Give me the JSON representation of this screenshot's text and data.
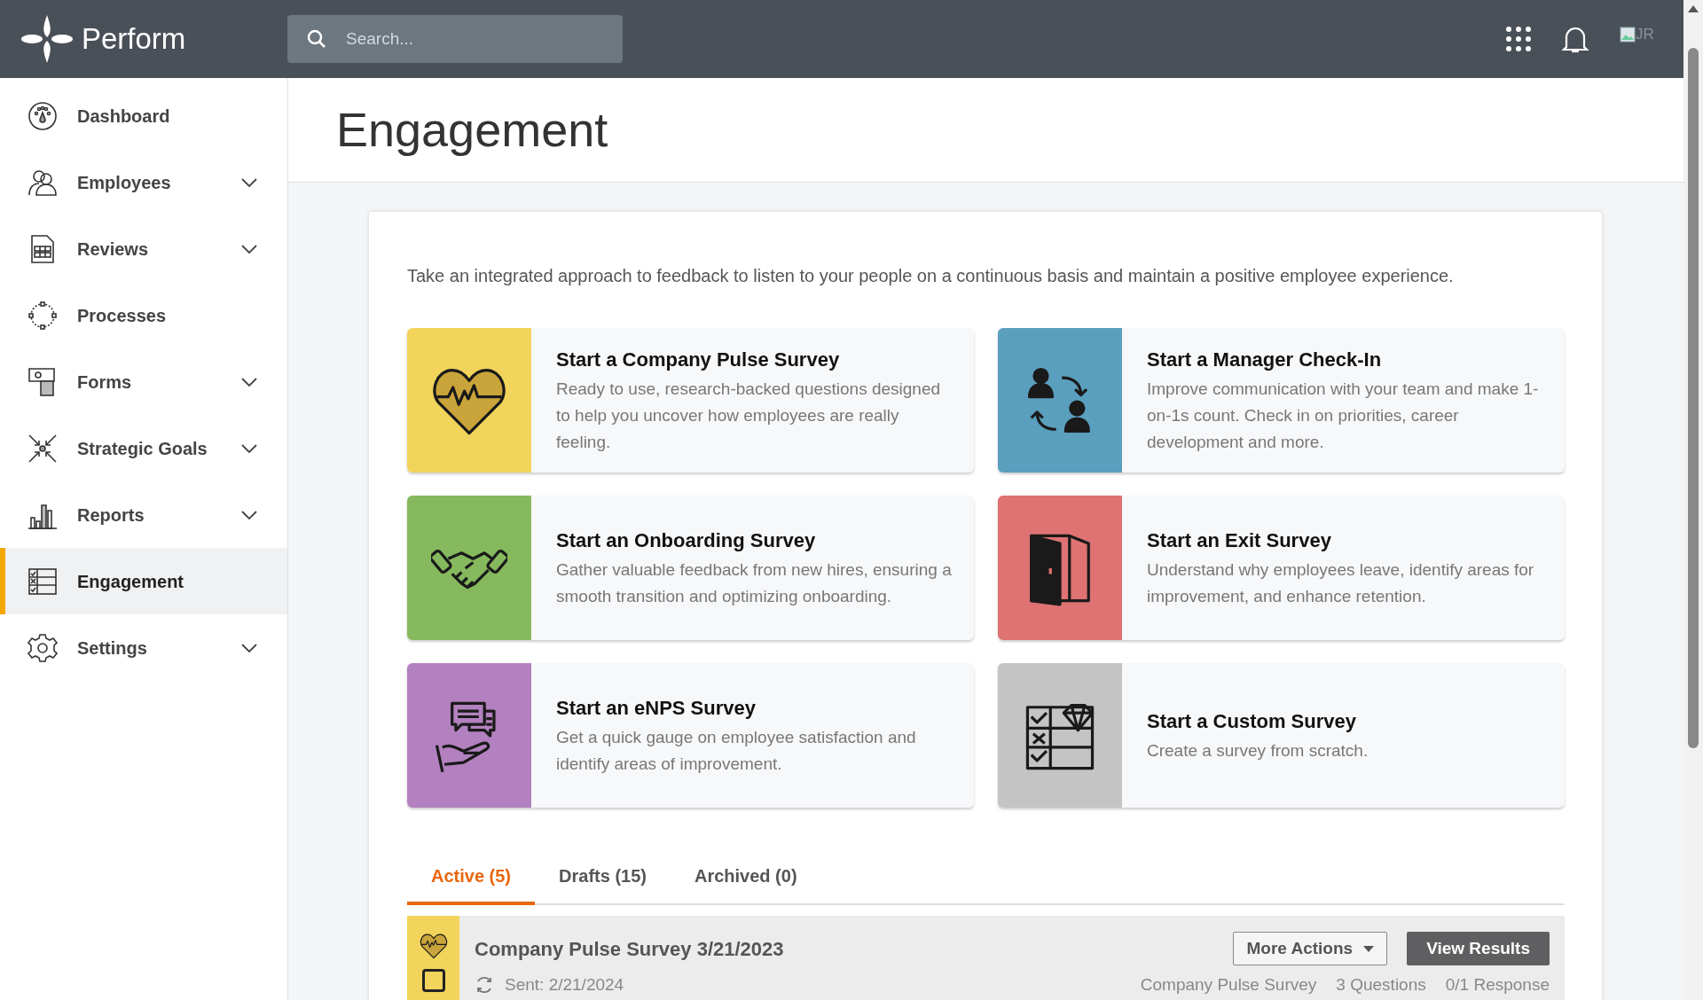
{
  "app": {
    "name": "Perform"
  },
  "search": {
    "placeholder": "Search..."
  },
  "user": {
    "initials": "JR"
  },
  "sidebar": {
    "items": [
      {
        "label": "Dashboard",
        "kind": "dashboard",
        "expandable": false,
        "selected": false
      },
      {
        "label": "Employees",
        "kind": "employees",
        "expandable": true,
        "selected": false
      },
      {
        "label": "Reviews",
        "kind": "reviews",
        "expandable": true,
        "selected": false
      },
      {
        "label": "Processes",
        "kind": "processes",
        "expandable": false,
        "selected": false
      },
      {
        "label": "Forms",
        "kind": "forms",
        "expandable": true,
        "selected": false
      },
      {
        "label": "Strategic Goals",
        "kind": "goals",
        "expandable": true,
        "selected": false
      },
      {
        "label": "Reports",
        "kind": "reports",
        "expandable": true,
        "selected": false
      },
      {
        "label": "Engagement",
        "kind": "engagement",
        "expandable": false,
        "selected": true
      },
      {
        "label": "Settings",
        "kind": "settings",
        "expandable": true,
        "selected": false
      }
    ]
  },
  "page": {
    "title": "Engagement"
  },
  "intro": "Take an integrated approach to feedback to listen to your people on a continuous basis and maintain a positive employee experience.",
  "templates": [
    {
      "title": "Start a Company Pulse Survey",
      "description": "Ready to use, research-backed questions designed to help you uncover how employees are really feeling.",
      "color": "#f2d35b",
      "kind": "heart"
    },
    {
      "title": "Start a Manager Check-In",
      "description": "Improve communication with your team and make 1-on-1s count. Check in on priorities, career development and more.",
      "color": "#5b9fbe",
      "kind": "checkin"
    },
    {
      "title": "Start an Onboarding Survey",
      "description": "Gather valuable feedback from new hires, ensuring a smooth transition and optimizing onboarding.",
      "color": "#86b95d",
      "kind": "handshake"
    },
    {
      "title": "Start an Exit Survey",
      "description": "Understand why employees leave, identify areas for improvement, and enhance retention.",
      "color": "#df7272",
      "kind": "door"
    },
    {
      "title": "Start an eNPS Survey",
      "description": "Get a quick gauge on employee satisfaction and identify areas of improvement.",
      "color": "#b381bf",
      "kind": "chat"
    },
    {
      "title": "Start a Custom Survey",
      "description": "Create a survey from scratch.",
      "color": "#c4c4c4",
      "kind": "custom"
    }
  ],
  "tabs": [
    {
      "label": "Active (5)",
      "selected": true
    },
    {
      "label": "Drafts (15)",
      "selected": false
    },
    {
      "label": "Archived (0)",
      "selected": false
    }
  ],
  "surveys": [
    {
      "title": "Company Pulse Survey 3/21/2023",
      "sent": "Sent: 2/21/2024",
      "type": "Company Pulse Survey",
      "questions": "3 Questions",
      "responses": "0/1 Response",
      "color": "#f2d35b",
      "kind": "heart"
    }
  ],
  "actions": {
    "more": "More Actions",
    "view": "View Results"
  }
}
